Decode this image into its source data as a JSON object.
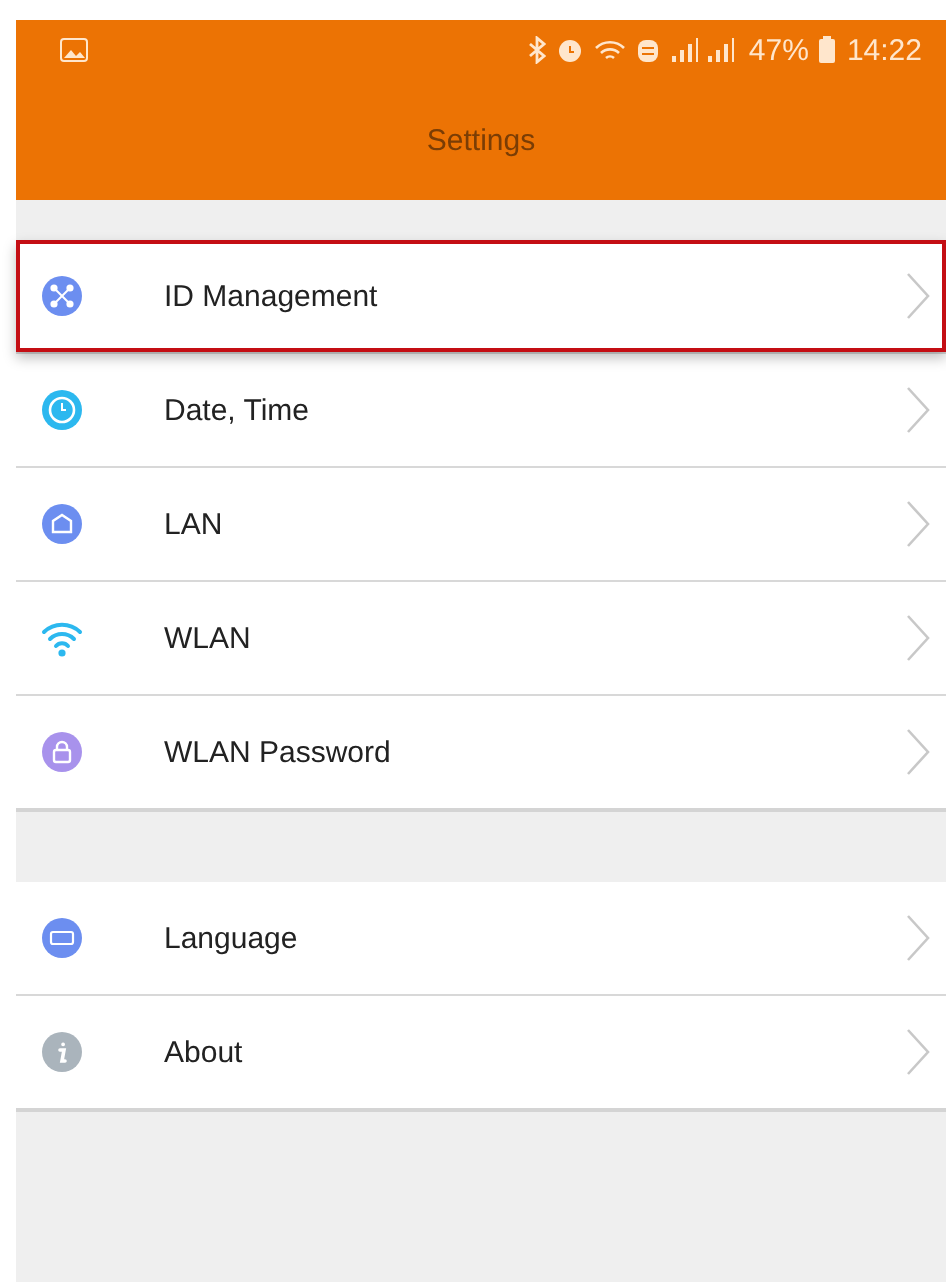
{
  "status_bar": {
    "battery": "47%",
    "time": "14:22"
  },
  "app_bar": {
    "title": "Settings"
  },
  "groups": [
    {
      "items": [
        {
          "label": "ID Management",
          "highlighted": true
        },
        {
          "label": "Date, Time",
          "highlighted": false
        },
        {
          "label": "LAN",
          "highlighted": false
        },
        {
          "label": "WLAN",
          "highlighted": false
        },
        {
          "label": "WLAN Password",
          "highlighted": false
        }
      ]
    },
    {
      "items": [
        {
          "label": "Language",
          "highlighted": false
        },
        {
          "label": "About",
          "highlighted": false
        }
      ]
    }
  ]
}
